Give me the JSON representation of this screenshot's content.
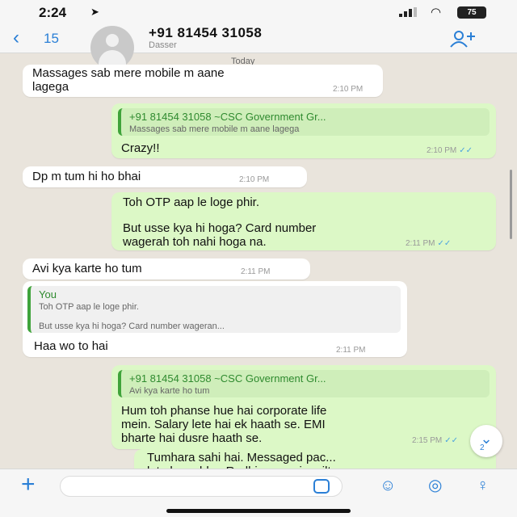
{
  "status_bar": {
    "time": "2:24",
    "location_glyph": "➤",
    "wifi_glyph": "◠",
    "battery": "75"
  },
  "header": {
    "back_glyph": "‹",
    "back_count": "15",
    "contact_name": "+91 81454 31058",
    "contact_subtitle": "Dasser",
    "add_glyph": "+"
  },
  "date_label": "Today",
  "messages": [
    {
      "text_lines": [
        "Massages sab mere mobile m aane",
        "lagega"
      ],
      "time": "2:10 PM"
    },
    {
      "quote_author": "+91 81454 31058 ~CSC Government Gr...",
      "quote_text": "Massages sab mere mobile m aane lagega",
      "text": "Crazy!!",
      "time": "2:10 PM"
    },
    {
      "text": "Dp m tum hi ho bhai",
      "time": "2:10 PM"
    },
    {
      "text_lines": [
        "Toh OTP aap le loge phir.",
        "",
        "But usse kya hi hoga? Card number",
        "wagerah toh nahi hoga na."
      ],
      "time": "2:11 PM"
    },
    {
      "text": "Avi kya karte ho tum",
      "time": "2:11 PM"
    },
    {
      "quote_author": "You",
      "quote_text_lines": [
        "Toh OTP aap le loge phir.",
        "But usse kya hi hoga? Card number wageran..."
      ],
      "text": "Haa wo to hai",
      "time": "2:11 PM"
    },
    {
      "quote_author": "+91 81454 31058 ~CSC Government Gr...",
      "quote_text": "Avi kya karte ho tum",
      "text_lines": [
        "Hum toh phanse hue hai corporate life",
        "mein. Salary lete hai ek haath se. EMI",
        "bharte hai dusre haath se."
      ],
      "time": "2:15 PM"
    },
    {
      "text_lines": [
        "Tumhara sahi hai. Messaged pac...",
        "lete ho sabke. Radhiya paccin milta"
      ]
    }
  ],
  "scroll_down": {
    "glyph": "⌄",
    "count": "2"
  },
  "input_bar": {
    "plus_glyph": "+",
    "placeholder": "",
    "camera_glyph": "◎",
    "mic_glyph": "♀",
    "emoji_glyph": "☺"
  },
  "colors": {
    "accent": "#2a7fd6",
    "outgoing": "#dcf8c6",
    "incoming": "#ffffff",
    "background": "#e9e4dc",
    "quote_bar": "#3fa33a"
  },
  "icons": [
    "location-icon",
    "signal-icon",
    "wifi-icon",
    "battery-icon",
    "back-chevron-icon",
    "avatar-icon",
    "add-participant-icon",
    "read-ticks-icon",
    "scroll-down-icon",
    "plus-icon",
    "sticker-icon",
    "emoji-icon",
    "camera-icon",
    "microphone-icon"
  ]
}
